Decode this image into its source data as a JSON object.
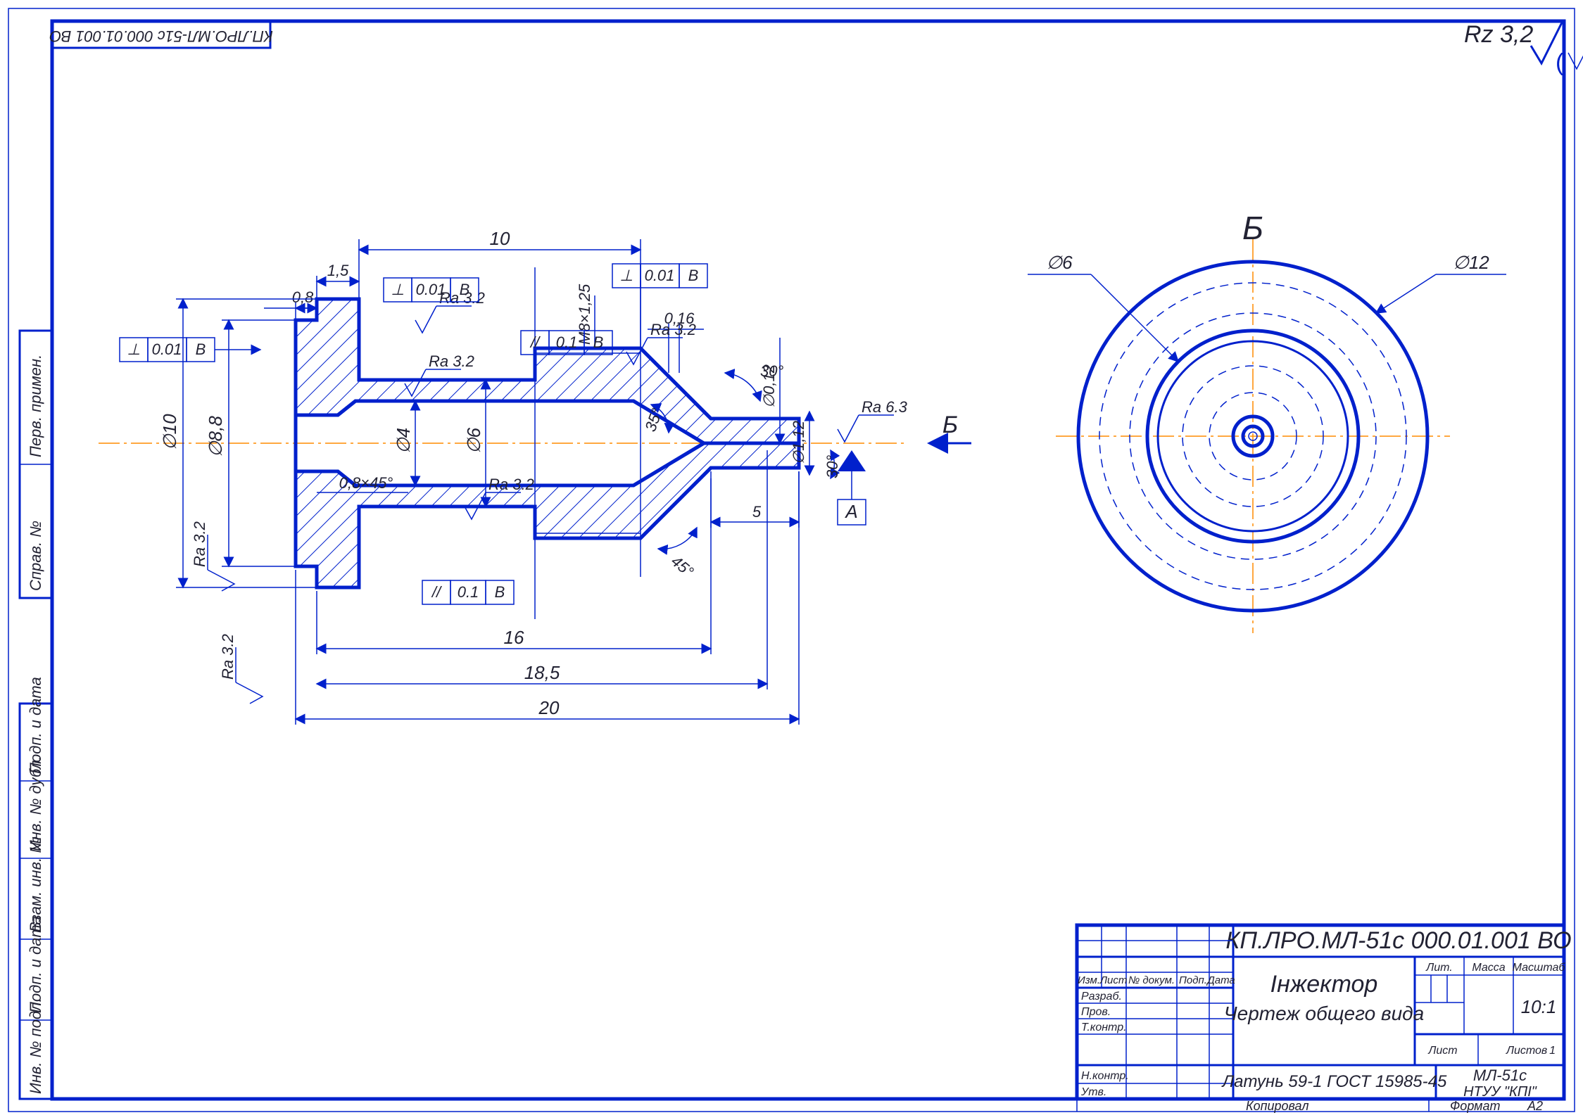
{
  "drawing_number_top": "КП.ЛРО.МЛ-51с 000.01.001 ВО",
  "surface_finish_global": "Rz 3,2",
  "paren_mark": "V",
  "views": {
    "section": {
      "dimensions": {
        "len_10": "10",
        "len_1_5": "1,5",
        "len_0_8": "0,8",
        "chamfer_08x45": "0,8×45°",
        "len_16": "16",
        "len_18_5": "18,5",
        "len_20": "20",
        "len_0_16": "0,16",
        "len_5": "5",
        "dia_10": "∅10",
        "dia_8_8": "∅8,8",
        "dia_4": "∅4",
        "dia_6_section": "∅6",
        "dia_0_12": "∅0,12",
        "dia_1_12": "∅1,12",
        "thread": "M8×1,25",
        "ang_30": "30°",
        "ang_35": "35°",
        "ang_45": "45°",
        "ang_30_lower": "30°"
      },
      "surface_finishes": {
        "ra32_1": "Ra 3.2",
        "ra32_2": "Ra 3.2",
        "ra32_3": "Ra 3.2",
        "ra32_4": "Ra 3.2",
        "ra32_5": "Ra 3.2",
        "ra32_6": "Ra 3.2",
        "ra63": "Ra 6.3"
      },
      "gd_t": {
        "perp_001_B_left": {
          "sym": "⊥",
          "tol": "0.01",
          "datum": "B"
        },
        "perp_001_B_top1": {
          "sym": "⊥",
          "tol": "0.01",
          "datum": "B"
        },
        "perp_001_B_top2": {
          "sym": "⊥",
          "tol": "0.01",
          "datum": "B"
        },
        "par_01_B_mid": {
          "sym": "//",
          "tol": "0.1",
          "datum": "B"
        },
        "par_01_B_bot": {
          "sym": "//",
          "tol": "0.1",
          "datum": "B"
        }
      },
      "datum_A": "А",
      "view_marker_B": "Б"
    },
    "view_B": {
      "label": "Б",
      "dia_6": "∅6",
      "dia_12": "∅12"
    }
  },
  "title_block": {
    "drawing_no": "КП.ЛРО.МЛ-51с 000.01.001 ВО",
    "name_line1": "Інжектор",
    "name_line2": "Чертеж общего вида",
    "material": "Латунь 59-1 ГОСТ 15985-45",
    "org_line1": "МЛ-51с",
    "org_line2": "НТУУ \"КПІ\"",
    "scale_label": "Масштаб",
    "scale_value": "10:1",
    "mass_label": "Масса",
    "lit_label": "Лит.",
    "sheet_label": "Лист",
    "sheets_label": "Листов",
    "sheets_value": "1",
    "format_label": "Формат",
    "format_value": "А2",
    "copy_label": "Копировал",
    "rev_headers": {
      "izm": "Изм.",
      "list": "Лист",
      "ndoc": "№ докум.",
      "podp": "Подп.",
      "date": "Дата"
    },
    "roles": {
      "razrab": "Разраб.",
      "prov": "Пров.",
      "tkontr": "Т.контр.",
      "nkontr": "Н.контр.",
      "utd": "Утв."
    }
  },
  "side_strip": {
    "inv_n_podl": "Инв. № подл.",
    "podp_data1": "Подп. и дата",
    "vzam_inv": "Взам. инв. №",
    "inv_n_dubl": "Инв. № дубл.",
    "podp_data2": "Подп. и дата",
    "sprav_n": "Справ. №",
    "perv_primen": "Перв. примен."
  }
}
